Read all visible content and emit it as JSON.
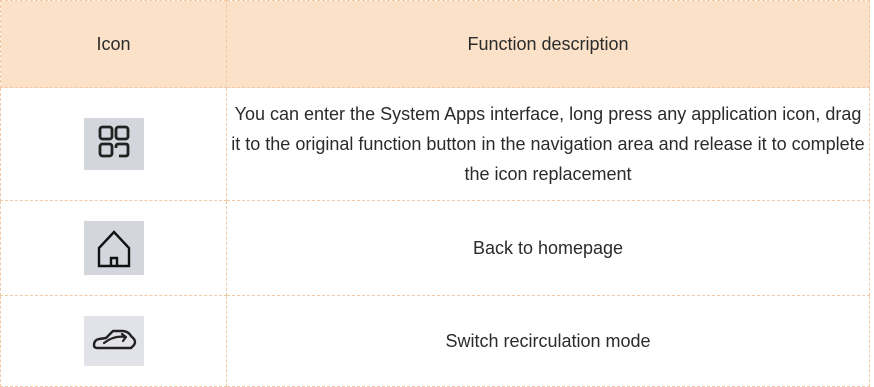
{
  "table": {
    "headers": {
      "icon": "Icon",
      "function": "Function description"
    },
    "rows": [
      {
        "icon": "apps-grid-icon",
        "description": "You can enter the System Apps interface, long press any application icon, drag it to the original function button in the navigation area and release it to complete the icon replacement"
      },
      {
        "icon": "home-icon",
        "description": "Back to homepage"
      },
      {
        "icon": "car-recirculation-icon",
        "description": "Switch recirculation mode"
      }
    ]
  }
}
